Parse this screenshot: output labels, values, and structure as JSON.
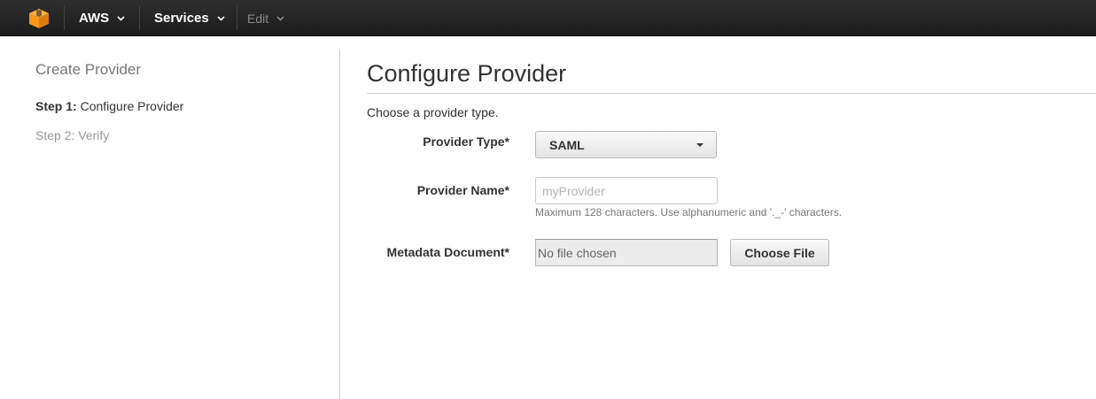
{
  "topbar": {
    "logo_icon": "aws-cube-icon",
    "aws_label": "AWS",
    "services_label": "Services",
    "edit_label": "Edit",
    "accent_color": "#f7981d"
  },
  "sidebar": {
    "title": "Create Provider",
    "step1_prefix": "Step 1:",
    "step1_label": "Configure Provider",
    "step2_label": "Step 2: Verify"
  },
  "main": {
    "title": "Configure Provider",
    "intro": "Choose a provider type.",
    "provider_type": {
      "label": "Provider Type*",
      "value": "SAML"
    },
    "provider_name": {
      "label": "Provider Name*",
      "placeholder": "myProvider",
      "value": "",
      "hint": "Maximum 128 characters. Use alphanumeric and '._-' characters."
    },
    "metadata": {
      "label": "Metadata Document*",
      "file_status": "No file chosen",
      "button_label": "Choose File"
    }
  }
}
